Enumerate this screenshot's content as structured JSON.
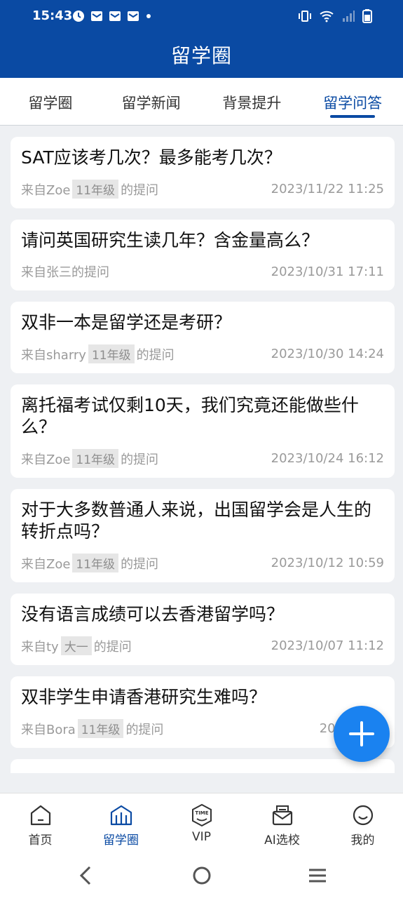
{
  "status_bar": {
    "time": "15:43"
  },
  "header": {
    "title": "留学圈"
  },
  "tabs": [
    {
      "label": "留学圈"
    },
    {
      "label": "留学新闻"
    },
    {
      "label": "背景提升"
    },
    {
      "label": "留学问答"
    }
  ],
  "posts": [
    {
      "question": "SAT应该考几次？最多能考几次？",
      "from": "来自Zoe",
      "grade": "11年级",
      "suffix": "的提问",
      "date": "2023/11/22 11:25"
    },
    {
      "question": "请问英国研究生读几年？含金量高么？",
      "from": "来自张三的提问",
      "grade": "",
      "suffix": "",
      "date": "2023/10/31 17:11"
    },
    {
      "question": "双非一本是留学还是考研？",
      "from": "来自sharry",
      "grade": "11年级",
      "suffix": "的提问",
      "date": "2023/10/30 14:24"
    },
    {
      "question": "离托福考试仅剩10天，我们究竟还能做些什么？",
      "from": "来自Zoe",
      "grade": "11年级",
      "suffix": "的提问",
      "date": "2023/10/24 16:12"
    },
    {
      "question": "对于大多数普通人来说，出国留学会是人生的转折点吗？",
      "from": "来自Zoe",
      "grade": "11年级",
      "suffix": "的提问",
      "date": "2023/10/12 10:59"
    },
    {
      "question": "没有语言成绩可以去香港留学吗？",
      "from": "来自ty",
      "grade": "大一",
      "suffix": "的提问",
      "date": "2023/10/07 11:12"
    },
    {
      "question": "双非学生申请香港研究生难吗？",
      "from": "来自Bora",
      "grade": "11年级",
      "suffix": "的提问",
      "date": "2023/09/2"
    }
  ],
  "bottom_nav": [
    {
      "label": "首页",
      "icon": "home-icon"
    },
    {
      "label": "留学圈",
      "icon": "building-icon"
    },
    {
      "label": "VIP",
      "icon": "vip-time-icon"
    },
    {
      "label": "AI选校",
      "icon": "mailbox-icon"
    },
    {
      "label": "我的",
      "icon": "smile-icon"
    }
  ],
  "colors": {
    "brand": "#0a4aa3",
    "fab": "#1a82f0"
  }
}
